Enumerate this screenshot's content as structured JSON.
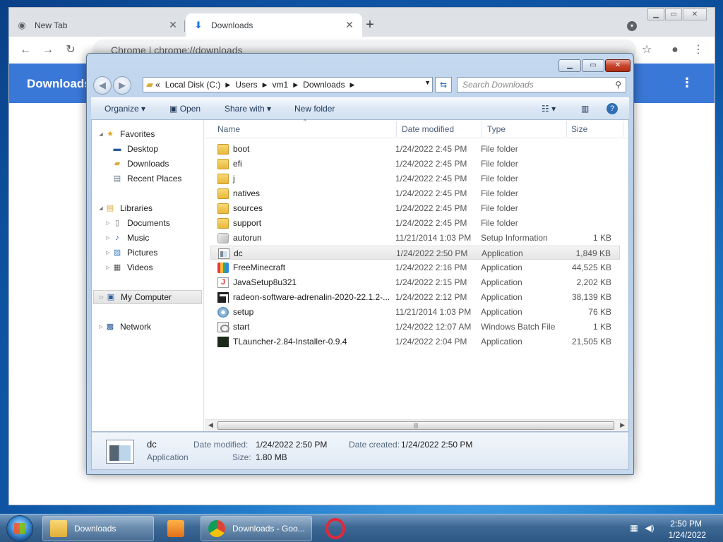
{
  "chrome": {
    "tabs": [
      {
        "label": "New Tab",
        "icon": "chrome-icon"
      },
      {
        "label": "Downloads",
        "icon": "download-icon"
      }
    ],
    "address_scheme": "Chrome",
    "address_url": "chrome://downloads",
    "header_title": "Downloads"
  },
  "explorer": {
    "breadcrumb": [
      "Local Disk (C:)",
      "Users",
      "vm1",
      "Downloads"
    ],
    "breadcrumb_prefix": "«",
    "search_placeholder": "Search Downloads",
    "commands": {
      "organize": "Organize",
      "open": "Open",
      "share_with": "Share with",
      "new_folder": "New folder"
    },
    "nav": {
      "favorites": "Favorites",
      "desktop": "Desktop",
      "downloads": "Downloads",
      "recent_places": "Recent Places",
      "libraries": "Libraries",
      "documents": "Documents",
      "music": "Music",
      "pictures": "Pictures",
      "videos": "Videos",
      "my_computer": "My Computer",
      "network": "Network"
    },
    "columns": {
      "name": "Name",
      "date_modified": "Date modified",
      "type": "Type",
      "size": "Size"
    },
    "files": [
      {
        "name": "boot",
        "date": "1/24/2022 2:45 PM",
        "type": "File folder",
        "size": "",
        "icon": "folder"
      },
      {
        "name": "efi",
        "date": "1/24/2022 2:45 PM",
        "type": "File folder",
        "size": "",
        "icon": "folder"
      },
      {
        "name": "j",
        "date": "1/24/2022 2:45 PM",
        "type": "File folder",
        "size": "",
        "icon": "folder"
      },
      {
        "name": "natives",
        "date": "1/24/2022 2:45 PM",
        "type": "File folder",
        "size": "",
        "icon": "folder"
      },
      {
        "name": "sources",
        "date": "1/24/2022 2:45 PM",
        "type": "File folder",
        "size": "",
        "icon": "folder"
      },
      {
        "name": "support",
        "date": "1/24/2022 2:45 PM",
        "type": "File folder",
        "size": "",
        "icon": "folder"
      },
      {
        "name": "autorun",
        "date": "11/21/2014 1:03 PM",
        "type": "Setup Information",
        "size": "1 KB",
        "icon": "setup"
      },
      {
        "name": "dc",
        "date": "1/24/2022 2:50 PM",
        "type": "Application",
        "size": "1,849 KB",
        "icon": "app"
      },
      {
        "name": "FreeMinecraft",
        "date": "1/24/2022 2:16 PM",
        "type": "Application",
        "size": "44,525 KB",
        "icon": "mc"
      },
      {
        "name": "JavaSetup8u321",
        "date": "1/24/2022 2:15 PM",
        "type": "Application",
        "size": "2,202 KB",
        "icon": "java"
      },
      {
        "name": "radeon-software-adrenalin-2020-22.1.2-...",
        "date": "1/24/2022 2:12 PM",
        "type": "Application",
        "size": "38,139 KB",
        "icon": "amd"
      },
      {
        "name": "setup",
        "date": "11/21/2014 1:03 PM",
        "type": "Application",
        "size": "76 KB",
        "icon": "gear"
      },
      {
        "name": "start",
        "date": "1/24/2022 12:07 AM",
        "type": "Windows Batch File",
        "size": "1 KB",
        "icon": "bat"
      },
      {
        "name": "TLauncher-2.84-Installer-0.9.4",
        "date": "1/24/2022 2:04 PM",
        "type": "Application",
        "size": "21,505 KB",
        "icon": "tl"
      }
    ],
    "selected_file_index": 7,
    "details": {
      "name": "dc",
      "type": "Application",
      "date_modified_label": "Date modified:",
      "date_modified": "1/24/2022 2:50 PM",
      "size_label": "Size:",
      "size": "1.80 MB",
      "date_created_label": "Date created:",
      "date_created": "1/24/2022 2:50 PM"
    }
  },
  "taskbar": {
    "explorer_label": "Downloads",
    "chrome_label": "Downloads - Goo...",
    "time": "2:50 PM",
    "date": "1/24/2022"
  }
}
